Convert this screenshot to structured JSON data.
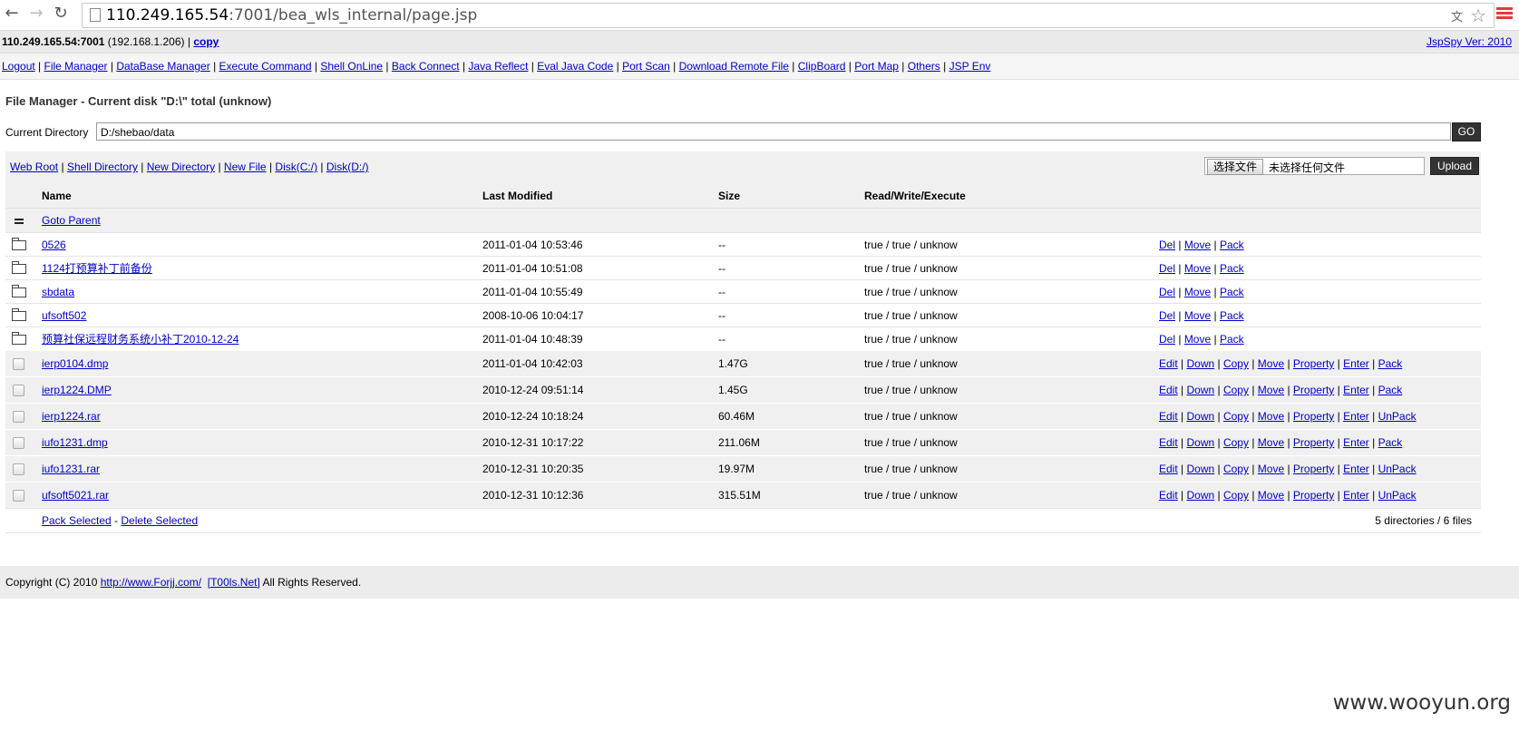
{
  "browser": {
    "url_host": "110.249.165.54",
    "url_rest": ":7001/bea_wls_internal/page.jsp"
  },
  "header": {
    "host": "110.249.165.54:7001",
    "internal_ip": "(192.168.1.206)",
    "separator": "|",
    "copy_label": "copy",
    "version": "JspSpy Ver: 2010"
  },
  "menu": [
    "Logout",
    "File Manager",
    "DataBase Manager",
    "Execute Command",
    "Shell OnLine",
    "Back Connect",
    "Java Reflect",
    "Eval Java Code",
    "Port Scan",
    "Download Remote File",
    "ClipBoard",
    "Port Map",
    "Others",
    "JSP Env"
  ],
  "file_manager": {
    "title": "File Manager - Current disk \"D:\\\" total (unknow)",
    "current_dir_label": "Current Directory",
    "current_dir_value": "D:/shebao/data",
    "go_label": "GO",
    "quick_links": [
      "Web Root",
      "Shell Directory",
      "New Directory",
      "New File",
      "Disk(C:/)",
      "Disk(D:/)"
    ],
    "choose_file_label": "选择文件",
    "no_file_label": "未选择任何文件",
    "upload_label": "Upload",
    "columns": {
      "name": "Name",
      "modified": "Last Modified",
      "size": "Size",
      "rwx": "Read/Write/Execute"
    },
    "goto_parent": "Goto Parent",
    "directories": [
      {
        "name": "0526",
        "modified": "2011-01-04 10:53:46",
        "size": "--",
        "rwx": "true / true / unknow",
        "actions": [
          "Del",
          "Move",
          "Pack"
        ]
      },
      {
        "name": "1124打预算补丁前备份",
        "modified": "2011-01-04 10:51:08",
        "size": "--",
        "rwx": "true / true / unknow",
        "actions": [
          "Del",
          "Move",
          "Pack"
        ]
      },
      {
        "name": "sbdata",
        "modified": "2011-01-04 10:55:49",
        "size": "--",
        "rwx": "true / true / unknow",
        "actions": [
          "Del",
          "Move",
          "Pack"
        ]
      },
      {
        "name": "ufsoft502",
        "modified": "2008-10-06 10:04:17",
        "size": "--",
        "rwx": "true / true / unknow",
        "actions": [
          "Del",
          "Move",
          "Pack"
        ]
      },
      {
        "name": "预算社保远程财务系统小补丁2010-12-24",
        "modified": "2011-01-04 10:48:39",
        "size": "--",
        "rwx": "true / true / unknow",
        "actions": [
          "Del",
          "Move",
          "Pack"
        ]
      }
    ],
    "files": [
      {
        "name": "ierp0104.dmp",
        "modified": "2011-01-04 10:42:03",
        "size": "1.47G",
        "rwx": "true / true / unknow",
        "actions": [
          "Edit",
          "Down",
          "Copy",
          "Move",
          "Property",
          "Enter",
          "Pack"
        ]
      },
      {
        "name": "ierp1224.DMP",
        "modified": "2010-12-24 09:51:14",
        "size": "1.45G",
        "rwx": "true / true / unknow",
        "actions": [
          "Edit",
          "Down",
          "Copy",
          "Move",
          "Property",
          "Enter",
          "Pack"
        ]
      },
      {
        "name": "ierp1224.rar",
        "modified": "2010-12-24 10:18:24",
        "size": "60.46M",
        "rwx": "true / true / unknow",
        "actions": [
          "Edit",
          "Down",
          "Copy",
          "Move",
          "Property",
          "Enter",
          "UnPack"
        ]
      },
      {
        "name": "iufo1231.dmp",
        "modified": "2010-12-31 10:17:22",
        "size": "211.06M",
        "rwx": "true / true / unknow",
        "actions": [
          "Edit",
          "Down",
          "Copy",
          "Move",
          "Property",
          "Enter",
          "Pack"
        ]
      },
      {
        "name": "iufo1231.rar",
        "modified": "2010-12-31 10:20:35",
        "size": "19.97M",
        "rwx": "true / true / unknow",
        "actions": [
          "Edit",
          "Down",
          "Copy",
          "Move",
          "Property",
          "Enter",
          "UnPack"
        ]
      },
      {
        "name": "ufsoft5021.rar",
        "modified": "2010-12-31 10:12:36",
        "size": "315.51M",
        "rwx": "true / true / unknow",
        "actions": [
          "Edit",
          "Down",
          "Copy",
          "Move",
          "Property",
          "Enter",
          "UnPack"
        ]
      }
    ],
    "pack_selected": "Pack Selected",
    "delete_selected": "Delete Selected",
    "summary": "5 directories / 6 files"
  },
  "footer": {
    "prefix": "Copyright (C) 2010",
    "link1": "http://www.Forjj.com/",
    "link2": "[T00ls.Net]",
    "suffix": "All Rights Reserved."
  },
  "watermark": "www.wooyun.org"
}
